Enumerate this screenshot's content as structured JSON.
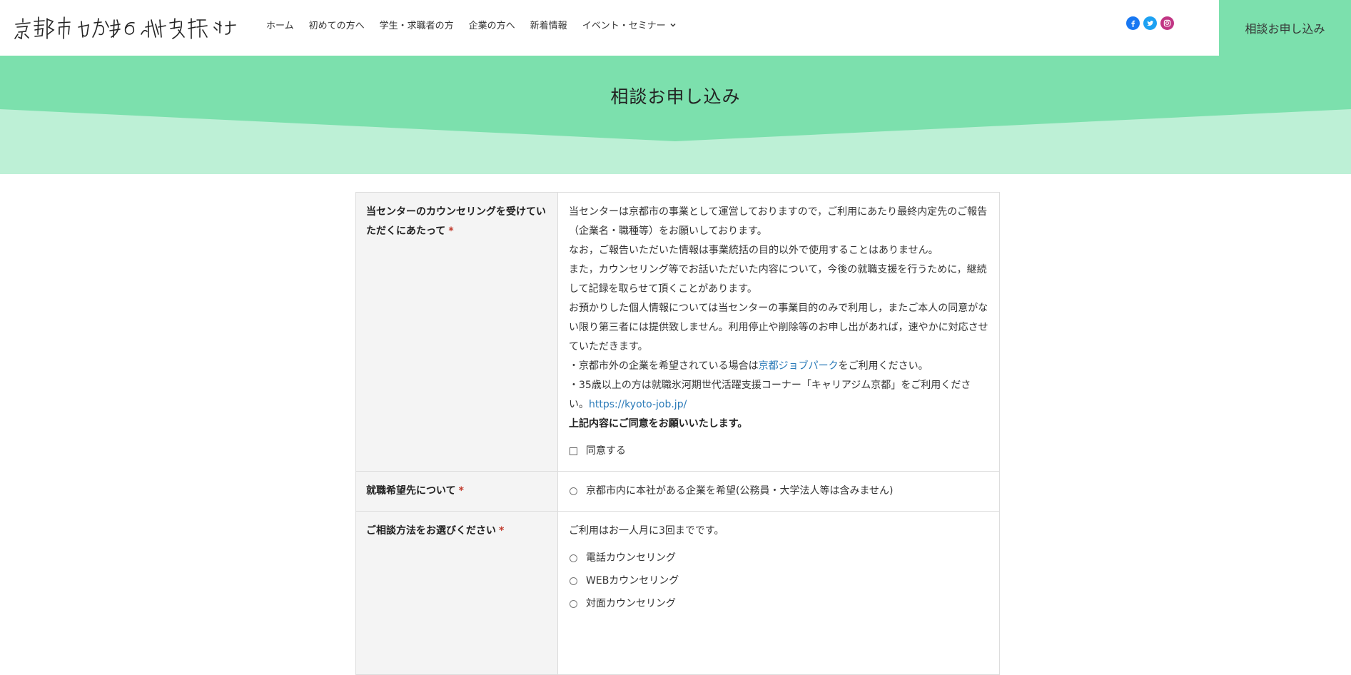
{
  "header": {
    "logo_text": "京都市わかもの就職支援センター",
    "nav": [
      {
        "label": "ホーム"
      },
      {
        "label": "初めての方へ"
      },
      {
        "label": "学生・求職者の方"
      },
      {
        "label": "企業の方へ"
      },
      {
        "label": "新着情報"
      },
      {
        "label": "イベント・セミナー",
        "icon": "chevron-down-icon"
      }
    ],
    "social": [
      {
        "icon": "facebook-icon",
        "color": "#1877f2"
      },
      {
        "icon": "twitter-icon",
        "color": "#1da1f2"
      },
      {
        "icon": "instagram-icon",
        "color": "#c13584"
      }
    ],
    "cta_label": "相談お申し込み"
  },
  "hero": {
    "title": "相談お申し込み",
    "colors": {
      "dark": "#7ce0ad",
      "light": "#bdf0d6"
    }
  },
  "form": {
    "rows": [
      {
        "label": "当センターのカウンセリングを受けていただくにあたって",
        "required_mark": "*",
        "paragraphs": [
          "当センターは京都市の事業として運営しておりますので，ご利用にあたり最終内定先のご報告（企業名・職種等）をお願いしております。",
          "なお，ご報告いただいた情報は事業統括の目的以外で使用することはありません。",
          "また，カウンセリング等でお話いただいた内容について，今後の就職支援を行うために，継続して記録を取らせて頂くことがあります。",
          "お預かりした個人情報については当センターの事業目的のみで利用し，またご本人の同意がない限り第三者には提供致しません。利用停止や削除等のお申し出があれば，速やかに対応させていただきます。"
        ],
        "line_job_park": {
          "before": "・京都市外の企業を希望されている場合は",
          "link": "京都ジョブパーク",
          "after": "をご利用ください。"
        },
        "line_career": {
          "text": "・35歳以上の方は就職氷河期世代活躍支援コーナー「キャリアジム京都」をご利用ください。",
          "link": "https://kyoto-job.jp/"
        },
        "agree_text": "上記内容にご同意をお願いいたします。",
        "checkbox_label": "同意する"
      },
      {
        "label": "就職希望先について",
        "required_mark": "*",
        "option": "京都市内に本社がある企業を希望(公務員・大学法人等は含みません)"
      },
      {
        "label": "ご相談方法をお選びください",
        "required_mark": "*",
        "note": "ご利用はお一人月に3回までです。",
        "options": [
          "電話カウンセリング",
          "WEBカウンセリング",
          "対面カウンセリング"
        ]
      }
    ]
  }
}
